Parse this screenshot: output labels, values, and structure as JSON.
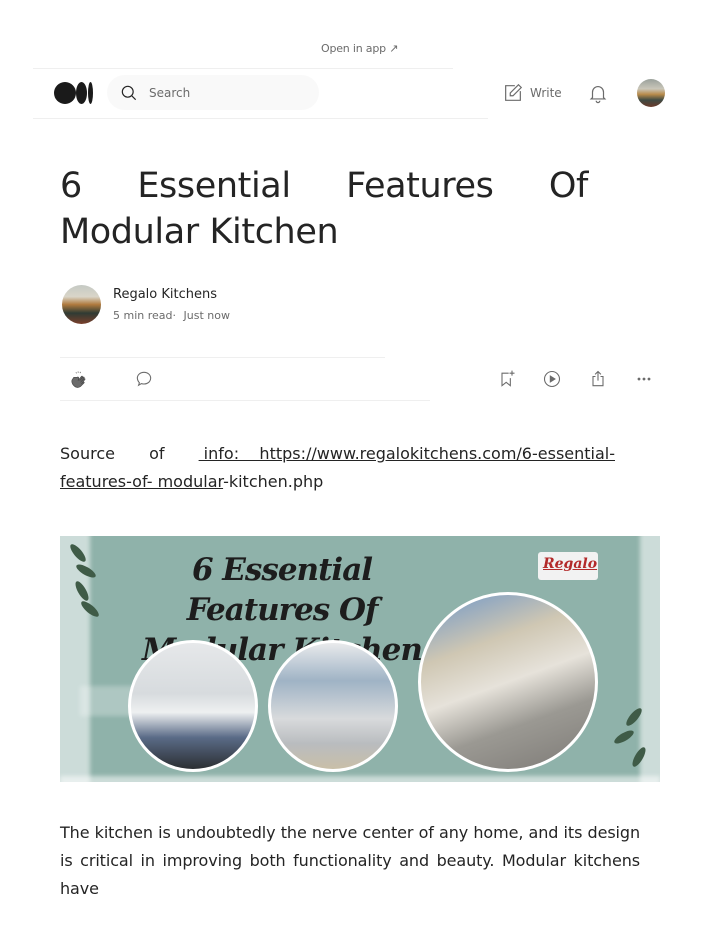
{
  "top_banner": {
    "open_in_app": "Open in app ↗"
  },
  "header": {
    "logo": "medium-logo",
    "search": {
      "placeholder": "Search",
      "value": ""
    },
    "write_label": "Write",
    "icons": [
      "search-icon",
      "write-icon",
      "bell-icon",
      "avatar"
    ]
  },
  "article": {
    "title_line1_words": [
      "6",
      "Essential",
      "Features",
      "Of"
    ],
    "title_line2": "Modular Kitchen",
    "author": {
      "name": "Regalo Kitchens",
      "read_time": "5 min read·",
      "published": "Just now"
    },
    "actions": {
      "left": [
        "clap-icon",
        "comment-icon"
      ],
      "right": [
        "bookmark-add-icon",
        "play-icon",
        "share-icon",
        "more-icon"
      ]
    },
    "source": {
      "words": [
        "Source",
        "of"
      ],
      "link_line1": " info:    https://www.regalokitchens.com/6-essential-",
      "link_line2": "features-of- modular",
      "plain_tail": "-kitchen.php"
    },
    "hero_image": {
      "title_line1": "6 Essential Features Of",
      "title_line2": "Modular Kitchen",
      "brand": "Regalo",
      "bg_color": "#8fb2aa"
    },
    "body": "The kitchen is undoubtedly the nerve center of any home, and its design is critical in improving both functionality and beauty. Modular kitchens have"
  }
}
